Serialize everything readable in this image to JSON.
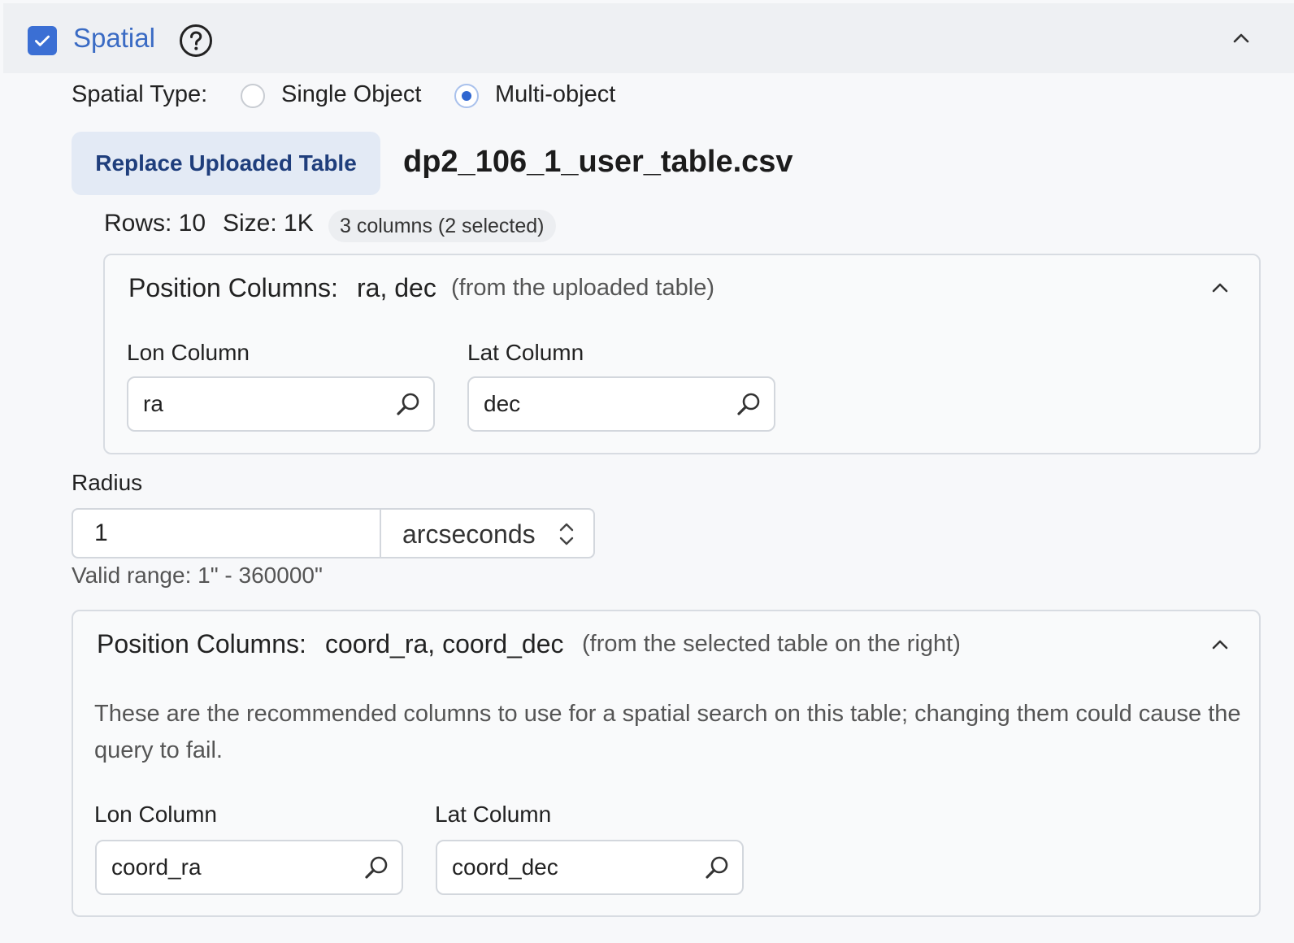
{
  "header": {
    "title": "Spatial",
    "checked": true,
    "help_icon": "question-circle-icon",
    "collapse_icon": "chevron-up-icon"
  },
  "spatial_type": {
    "label": "Spatial Type:",
    "options": [
      {
        "label": "Single Object",
        "selected": false
      },
      {
        "label": "Multi-object",
        "selected": true
      }
    ]
  },
  "upload": {
    "button_label": "Replace Uploaded Table",
    "filename": "dp2_106_1_user_table.csv",
    "rows_text": "Rows: 10",
    "size_text": "Size: 1K",
    "columns_badge": "3 columns (2 selected)"
  },
  "uploaded_position": {
    "title": "Position Columns:",
    "value": "ra, dec",
    "note": "(from the uploaded table)",
    "lon_label": "Lon Column",
    "lon_value": "ra",
    "lat_label": "Lat Column",
    "lat_value": "dec"
  },
  "radius": {
    "label": "Radius",
    "value": "1",
    "unit": "arcseconds",
    "hint": "Valid range: 1\" - 360000\""
  },
  "table_position": {
    "title": "Position Columns:",
    "value": "coord_ra, coord_dec",
    "note": "(from the selected table on the right)",
    "description_line1": "These are the recommended columns to use for a spatial search on this table; changing them could cause the",
    "description_line2": "query to fail.",
    "lon_label": "Lon Column",
    "lon_value": "coord_ra",
    "lat_label": "Lat Column",
    "lat_value": "coord_dec"
  },
  "colors": {
    "accent": "#3b6fd4",
    "title": "#3a6bc4",
    "button_bg": "#e3eaf5",
    "button_text": "#1f3e7c"
  }
}
